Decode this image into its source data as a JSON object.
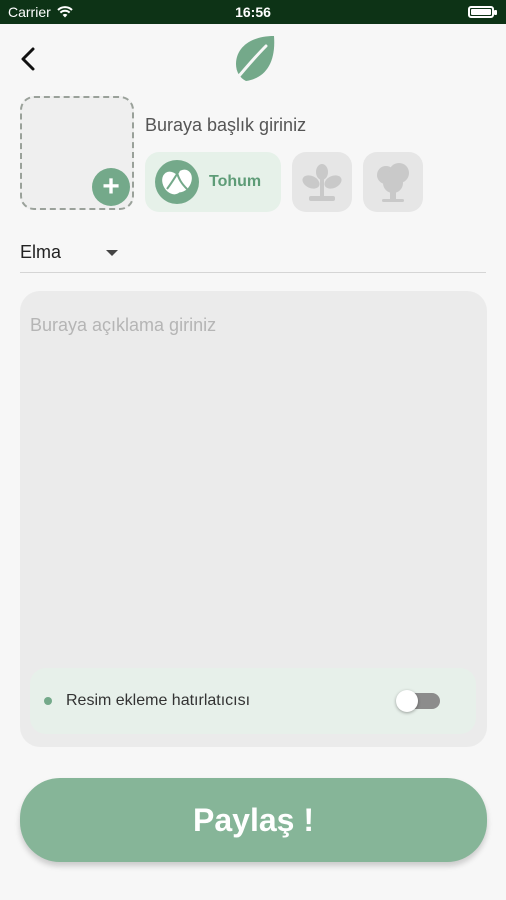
{
  "status_bar": {
    "carrier": "Carrier",
    "time": "16:56"
  },
  "form": {
    "title_placeholder": "Buraya başlık giriniz",
    "categories": [
      {
        "label": "Tohum",
        "icon": "seed-icon",
        "selected": true
      },
      {
        "label": "",
        "icon": "sapling-icon",
        "selected": false
      },
      {
        "label": "",
        "icon": "tree-icon",
        "selected": false
      }
    ],
    "plant_select_value": "Elma",
    "description_placeholder": "Buraya açıklama giriniz",
    "reminder_label": "Resim ekleme hatırlatıcısı",
    "reminder_enabled": false,
    "share_label": "Paylaş !"
  },
  "colors": {
    "accent": "#74a98a",
    "button": "#86b598",
    "status_bar": "#0d3316",
    "seed_chip_bg": "#e6f1e9"
  }
}
